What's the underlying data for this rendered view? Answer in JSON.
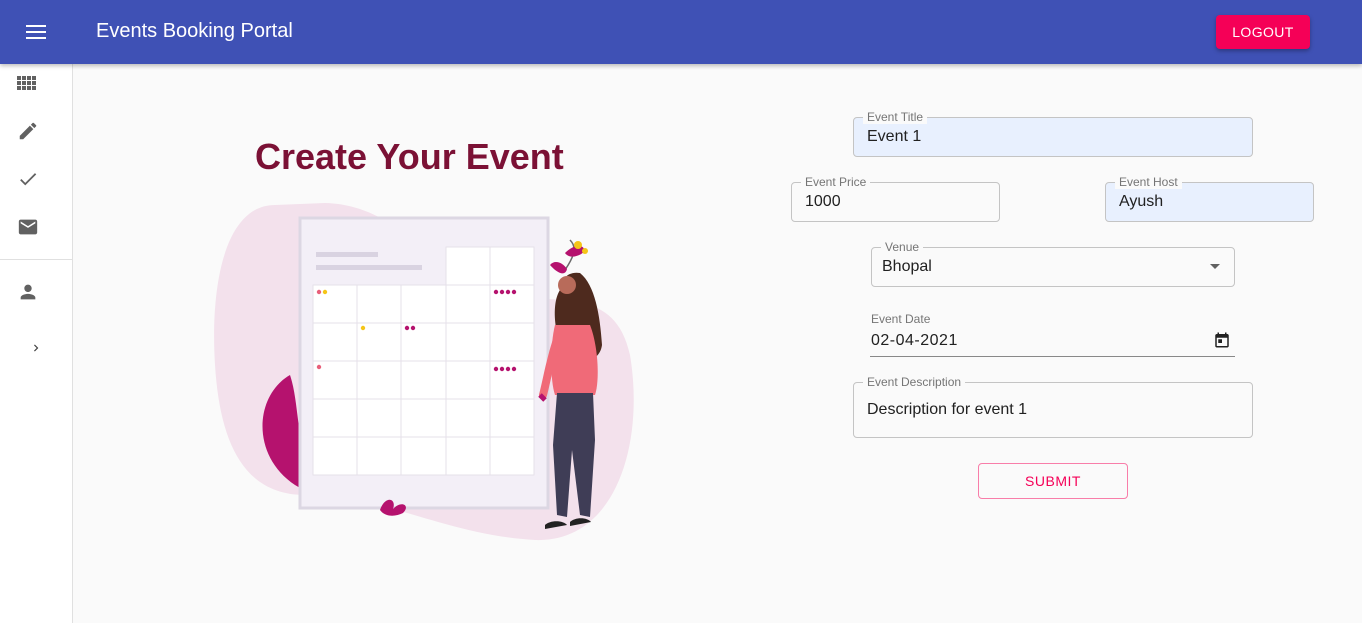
{
  "appbar": {
    "menu_icon": "menu-icon",
    "title": "Events Booking Portal",
    "logout_label": "LOGOUT",
    "color": "#3f51b5",
    "accent": "#f50057"
  },
  "drawer": {
    "items": [
      {
        "icon": "apps-grid-icon"
      },
      {
        "icon": "edit-pencil-icon"
      },
      {
        "icon": "check-icon"
      },
      {
        "icon": "mail-icon"
      },
      {
        "icon": "person-icon"
      }
    ],
    "expand_icon": "chevron-right-icon"
  },
  "main": {
    "heading": "Create Your Event",
    "illustration": "woman-with-calendar-illustration"
  },
  "form": {
    "event_title": {
      "label": "Event Title",
      "value": "Event 1"
    },
    "event_price": {
      "label": "Event Price",
      "value": "1000"
    },
    "event_host": {
      "label": "Event Host",
      "value": "Ayush"
    },
    "venue": {
      "label": "Venue",
      "value": "Bhopal"
    },
    "event_date": {
      "label": "Event Date",
      "value": "02-04-2021"
    },
    "event_description": {
      "label": "Event Description",
      "value": "Description for event 1"
    },
    "submit_label": "SUBMIT"
  }
}
